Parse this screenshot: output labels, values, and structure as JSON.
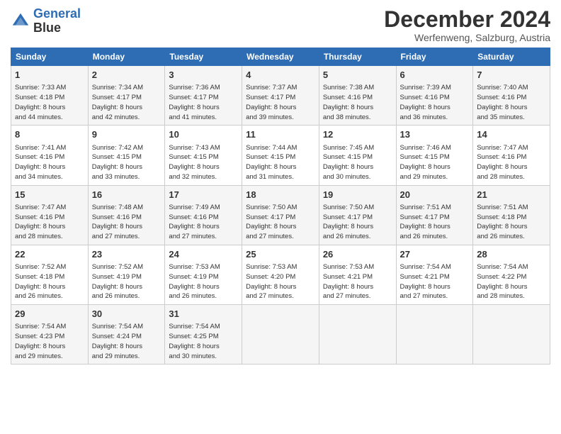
{
  "logo": {
    "line1": "General",
    "line2": "Blue"
  },
  "title": "December 2024",
  "subtitle": "Werfenweng, Salzburg, Austria",
  "days_of_week": [
    "Sunday",
    "Monday",
    "Tuesday",
    "Wednesday",
    "Thursday",
    "Friday",
    "Saturday"
  ],
  "weeks": [
    [
      {
        "day": "1",
        "info": "Sunrise: 7:33 AM\nSunset: 4:18 PM\nDaylight: 8 hours\nand 44 minutes."
      },
      {
        "day": "2",
        "info": "Sunrise: 7:34 AM\nSunset: 4:17 PM\nDaylight: 8 hours\nand 42 minutes."
      },
      {
        "day": "3",
        "info": "Sunrise: 7:36 AM\nSunset: 4:17 PM\nDaylight: 8 hours\nand 41 minutes."
      },
      {
        "day": "4",
        "info": "Sunrise: 7:37 AM\nSunset: 4:17 PM\nDaylight: 8 hours\nand 39 minutes."
      },
      {
        "day": "5",
        "info": "Sunrise: 7:38 AM\nSunset: 4:16 PM\nDaylight: 8 hours\nand 38 minutes."
      },
      {
        "day": "6",
        "info": "Sunrise: 7:39 AM\nSunset: 4:16 PM\nDaylight: 8 hours\nand 36 minutes."
      },
      {
        "day": "7",
        "info": "Sunrise: 7:40 AM\nSunset: 4:16 PM\nDaylight: 8 hours\nand 35 minutes."
      }
    ],
    [
      {
        "day": "8",
        "info": "Sunrise: 7:41 AM\nSunset: 4:16 PM\nDaylight: 8 hours\nand 34 minutes."
      },
      {
        "day": "9",
        "info": "Sunrise: 7:42 AM\nSunset: 4:15 PM\nDaylight: 8 hours\nand 33 minutes."
      },
      {
        "day": "10",
        "info": "Sunrise: 7:43 AM\nSunset: 4:15 PM\nDaylight: 8 hours\nand 32 minutes."
      },
      {
        "day": "11",
        "info": "Sunrise: 7:44 AM\nSunset: 4:15 PM\nDaylight: 8 hours\nand 31 minutes."
      },
      {
        "day": "12",
        "info": "Sunrise: 7:45 AM\nSunset: 4:15 PM\nDaylight: 8 hours\nand 30 minutes."
      },
      {
        "day": "13",
        "info": "Sunrise: 7:46 AM\nSunset: 4:15 PM\nDaylight: 8 hours\nand 29 minutes."
      },
      {
        "day": "14",
        "info": "Sunrise: 7:47 AM\nSunset: 4:16 PM\nDaylight: 8 hours\nand 28 minutes."
      }
    ],
    [
      {
        "day": "15",
        "info": "Sunrise: 7:47 AM\nSunset: 4:16 PM\nDaylight: 8 hours\nand 28 minutes."
      },
      {
        "day": "16",
        "info": "Sunrise: 7:48 AM\nSunset: 4:16 PM\nDaylight: 8 hours\nand 27 minutes."
      },
      {
        "day": "17",
        "info": "Sunrise: 7:49 AM\nSunset: 4:16 PM\nDaylight: 8 hours\nand 27 minutes."
      },
      {
        "day": "18",
        "info": "Sunrise: 7:50 AM\nSunset: 4:17 PM\nDaylight: 8 hours\nand 27 minutes."
      },
      {
        "day": "19",
        "info": "Sunrise: 7:50 AM\nSunset: 4:17 PM\nDaylight: 8 hours\nand 26 minutes."
      },
      {
        "day": "20",
        "info": "Sunrise: 7:51 AM\nSunset: 4:17 PM\nDaylight: 8 hours\nand 26 minutes."
      },
      {
        "day": "21",
        "info": "Sunrise: 7:51 AM\nSunset: 4:18 PM\nDaylight: 8 hours\nand 26 minutes."
      }
    ],
    [
      {
        "day": "22",
        "info": "Sunrise: 7:52 AM\nSunset: 4:18 PM\nDaylight: 8 hours\nand 26 minutes."
      },
      {
        "day": "23",
        "info": "Sunrise: 7:52 AM\nSunset: 4:19 PM\nDaylight: 8 hours\nand 26 minutes."
      },
      {
        "day": "24",
        "info": "Sunrise: 7:53 AM\nSunset: 4:19 PM\nDaylight: 8 hours\nand 26 minutes."
      },
      {
        "day": "25",
        "info": "Sunrise: 7:53 AM\nSunset: 4:20 PM\nDaylight: 8 hours\nand 27 minutes."
      },
      {
        "day": "26",
        "info": "Sunrise: 7:53 AM\nSunset: 4:21 PM\nDaylight: 8 hours\nand 27 minutes."
      },
      {
        "day": "27",
        "info": "Sunrise: 7:54 AM\nSunset: 4:21 PM\nDaylight: 8 hours\nand 27 minutes."
      },
      {
        "day": "28",
        "info": "Sunrise: 7:54 AM\nSunset: 4:22 PM\nDaylight: 8 hours\nand 28 minutes."
      }
    ],
    [
      {
        "day": "29",
        "info": "Sunrise: 7:54 AM\nSunset: 4:23 PM\nDaylight: 8 hours\nand 29 minutes."
      },
      {
        "day": "30",
        "info": "Sunrise: 7:54 AM\nSunset: 4:24 PM\nDaylight: 8 hours\nand 29 minutes."
      },
      {
        "day": "31",
        "info": "Sunrise: 7:54 AM\nSunset: 4:25 PM\nDaylight: 8 hours\nand 30 minutes."
      },
      {
        "day": "",
        "info": ""
      },
      {
        "day": "",
        "info": ""
      },
      {
        "day": "",
        "info": ""
      },
      {
        "day": "",
        "info": ""
      }
    ]
  ]
}
